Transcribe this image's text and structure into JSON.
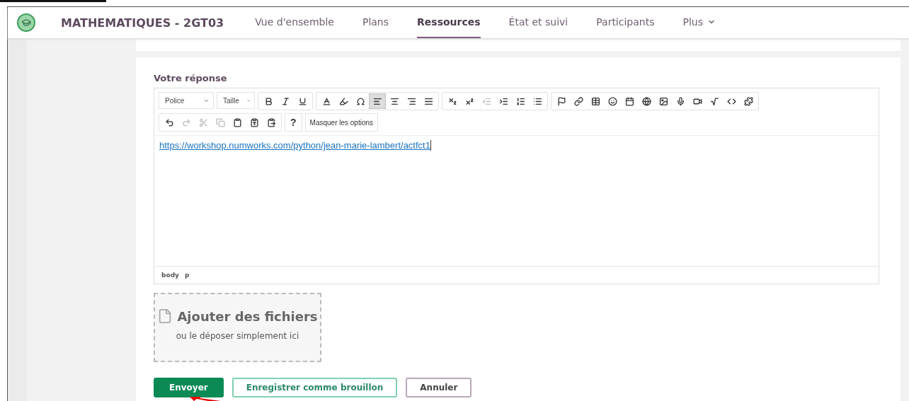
{
  "header": {
    "course": "MATHEMATIQUES - 2GT03",
    "tabs": [
      {
        "label": "Vue d'ensemble",
        "selected": false
      },
      {
        "label": "Plans",
        "selected": false
      },
      {
        "label": "Ressources",
        "selected": true
      },
      {
        "label": "État et suivi",
        "selected": false
      },
      {
        "label": "Participants",
        "selected": false
      },
      {
        "label": "Plus",
        "selected": false,
        "kind": "dropdown"
      }
    ]
  },
  "answer": {
    "label": "Votre réponse",
    "toolbar": {
      "font": "Police",
      "size": "Taille",
      "alignment": [
        {
          "selected": true
        },
        {
          "selected": false
        },
        {
          "selected": false
        },
        {
          "selected": false
        }
      ],
      "help": "?",
      "toggle": "Masquer les options"
    },
    "content": {
      "link": "https://workshop.numworks.com/python/jean-marie-lambert/actfct1"
    },
    "path": [
      "body",
      "p"
    ]
  },
  "upload": {
    "title": "Ajouter des fichiers",
    "hint": "ou le déposer simplement ici"
  },
  "buttons": [
    {
      "label": "Envoyer",
      "kind": "primary"
    },
    {
      "label": "Enregistrer comme brouillon",
      "kind": "outline"
    },
    {
      "label": "Annuler",
      "kind": "secondary"
    }
  ]
}
